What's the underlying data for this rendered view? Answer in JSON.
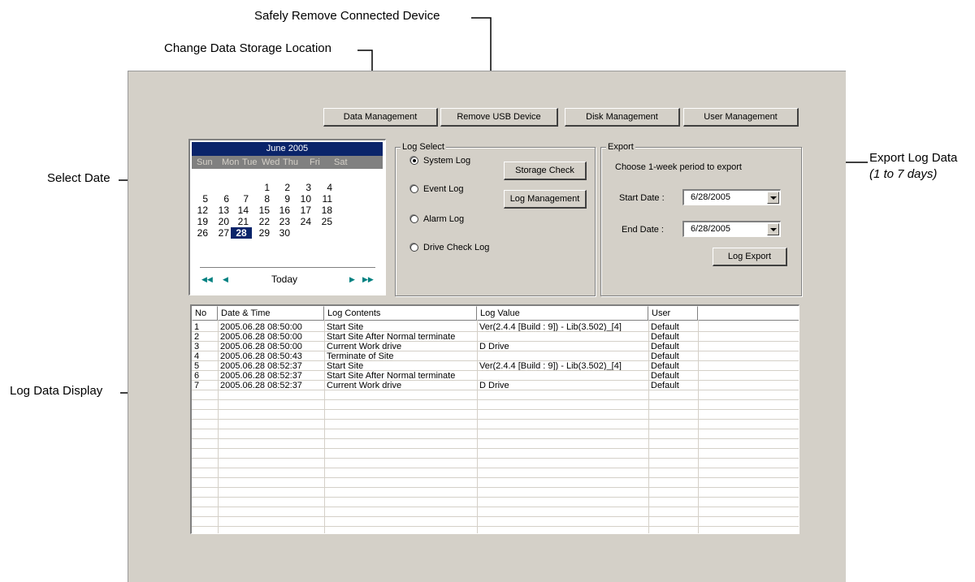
{
  "annotations": {
    "safely_remove": "Safely Remove Connected Device",
    "change_storage": "Change Data Storage Location",
    "select_date": "Select Date",
    "export_log": "Export Log Data",
    "export_log_sub": "(1 to 7 days)",
    "log_display": "Log Data Display"
  },
  "toolbar": {
    "data_management": "Data Management",
    "remove_usb": "Remove USB Device",
    "disk_management": "Disk Management",
    "user_management": "User Management"
  },
  "calendar": {
    "title": "June 2005",
    "weekdays": [
      "Sun",
      "Mon",
      "Tue",
      "Wed",
      "Thu",
      "Fri",
      "Sat"
    ],
    "weeks": [
      [
        "",
        "",
        "",
        "1",
        "2",
        "3",
        "4"
      ],
      [
        "5",
        "6",
        "7",
        "8",
        "9",
        "10",
        "11"
      ],
      [
        "12",
        "13",
        "14",
        "15",
        "16",
        "17",
        "18"
      ],
      [
        "19",
        "20",
        "21",
        "22",
        "23",
        "24",
        "25"
      ],
      [
        "26",
        "27",
        "28",
        "29",
        "30",
        "",
        ""
      ]
    ],
    "selected_day": "28",
    "today_label": "Today"
  },
  "log_select": {
    "legend": "Log Select",
    "options": [
      "System Log",
      "Event Log",
      "Alarm Log",
      "Drive Check Log"
    ],
    "selected": "System Log",
    "storage_check": "Storage Check",
    "log_management": "Log Management"
  },
  "export": {
    "legend": "Export",
    "hint": "Choose 1-week period to export",
    "start_label": "Start Date :",
    "start_value": "6/28/2005",
    "end_label": "End Date :",
    "end_value": "6/28/2005",
    "export_button": "Log Export"
  },
  "log_table": {
    "columns": [
      "No",
      "Date & Time",
      "Log Contents",
      "Log Value",
      "User",
      ""
    ],
    "rows": [
      [
        "1",
        "2005.06.28 08:50:00",
        "Start Site",
        "Ver(2.4.4 [Build : 9])  - Lib(3.502)_[4]",
        "Default"
      ],
      [
        "2",
        "2005.06.28 08:50:00",
        "Start Site After Normal terminate",
        "",
        "Default"
      ],
      [
        "3",
        "2005.06.28 08:50:00",
        "Current Work drive",
        "D Drive",
        "Default"
      ],
      [
        "4",
        "2005.06.28 08:50:43",
        "Terminate of Site",
        "",
        "Default"
      ],
      [
        "5",
        "2005.06.28 08:52:37",
        "Start Site",
        "Ver(2.4.4 [Build : 9])  - Lib(3.502)_[4]",
        "Default"
      ],
      [
        "6",
        "2005.06.28 08:52:37",
        "Start Site After Normal terminate",
        "",
        "Default"
      ],
      [
        "7",
        "2005.06.28 08:52:37",
        "Current Work drive",
        "D Drive",
        "Default"
      ]
    ]
  },
  "colors": {
    "panel": "#d4d0c8",
    "selection": "#0a246a",
    "shadow": "#808080"
  }
}
